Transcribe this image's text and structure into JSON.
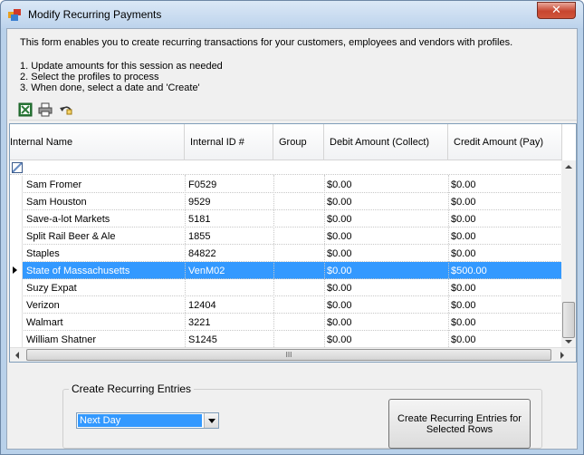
{
  "window": {
    "title": "Modify Recurring Payments",
    "close_label": "✕"
  },
  "intro": "This form enables you to create recurring transactions for your customers, employees and vendors with profiles.",
  "steps": [
    "1. Update amounts for this session as needed",
    "2. Select the profiles to process",
    "3. When done, select a date and 'Create'"
  ],
  "grid": {
    "columns": [
      "Internal Name",
      "Internal ID #",
      "Group",
      "Debit Amount (Collect)",
      "Credit Amount (Pay)"
    ],
    "rows": [
      {
        "name": "Sam Fromer",
        "id": "F0529",
        "group": "",
        "debit": "$0.00",
        "credit": "$0.00"
      },
      {
        "name": "Sam Houston",
        "id": "9529",
        "group": "",
        "debit": "$0.00",
        "credit": "$0.00"
      },
      {
        "name": "Save-a-lot Markets",
        "id": "5181",
        "group": "",
        "debit": "$0.00",
        "credit": "$0.00"
      },
      {
        "name": "Split Rail Beer & Ale",
        "id": "1855",
        "group": "",
        "debit": "$0.00",
        "credit": "$0.00"
      },
      {
        "name": "Staples",
        "id": "84822",
        "group": "",
        "debit": "$0.00",
        "credit": "$0.00"
      },
      {
        "name": "State of Massachusetts",
        "id": "VenM02",
        "group": "",
        "debit": "$0.00",
        "credit": "$500.00"
      },
      {
        "name": "Suzy Expat",
        "id": "",
        "group": "",
        "debit": "$0.00",
        "credit": "$0.00"
      },
      {
        "name": "Verizon",
        "id": "12404",
        "group": "",
        "debit": "$0.00",
        "credit": "$0.00"
      },
      {
        "name": "Walmart",
        "id": "3221",
        "group": "",
        "debit": "$0.00",
        "credit": "$0.00"
      },
      {
        "name": "William Shatner",
        "id": "S1245",
        "group": "",
        "debit": "$0.00",
        "credit": "$0.00"
      }
    ],
    "selected_row": 5,
    "hscroll_grip": "III"
  },
  "recurring": {
    "group_label": "Create Recurring Entries",
    "selected_option": "Next Day",
    "create_label": "Create Recurring Entries for Selected Rows"
  },
  "icons": [
    "app-icon",
    "excel-icon",
    "print-icon",
    "undo-icon",
    "filter-icon"
  ],
  "colors": {
    "selection": "#3399ff",
    "close": "#c7452f"
  }
}
